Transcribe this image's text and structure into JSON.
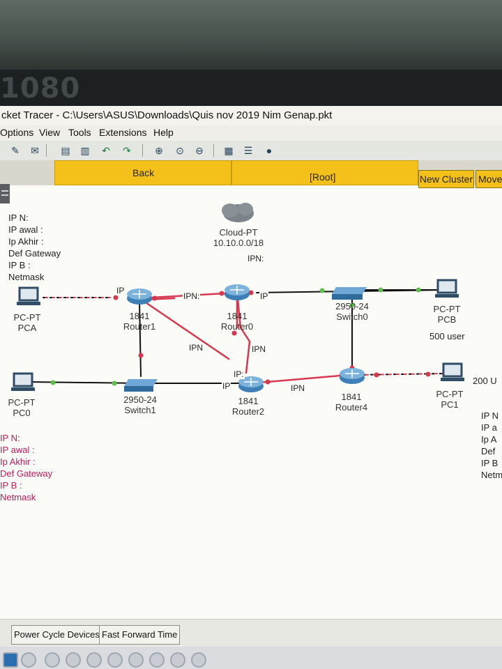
{
  "desktop": {
    "resolution_label": "1080"
  },
  "window": {
    "title": "cket Tracer - C:\\Users\\ASUS\\Downloads\\Quis nov 2019 Nim Genap.pkt"
  },
  "menu": [
    "Options",
    "View",
    "Tools",
    "Extensions",
    "Help"
  ],
  "toolbar": {
    "icons": [
      "activity-wizard-icon",
      "message-icon",
      "copy-icon",
      "print-icon",
      "undo-icon",
      "redo-icon",
      "zoom-in-icon",
      "zoom-reset-icon",
      "zoom-out-icon",
      "palette-icon",
      "device-template-icon",
      "cluster-icon"
    ]
  },
  "logical_bar": {
    "back_label": "Back",
    "root_label": "[Root]",
    "new_cluster_label": "New Cluster",
    "move_label": "Move"
  },
  "notes": {
    "top_left": "IP N:\nIP awal :\nIp Akhir :\nDef Gateway\nIP B :\nNetmask",
    "bottom_left": "IP N:\nIP awal :\nIp Akhir :\nDef Gateway\nIP B :\nNetmask",
    "right": "IP N\nIP a\nIp A\nDef\nIP B\nNetm",
    "pcb_users": "500 user",
    "pc1_users": "200 U"
  },
  "devices": {
    "cloud": {
      "model": "Cloud-PT",
      "network": "10.10.0.0/18"
    },
    "router0": {
      "model": "1841",
      "name": "Router0"
    },
    "router1": {
      "model": "1841",
      "name": "Router1"
    },
    "router2": {
      "model": "1841",
      "name": "Router2"
    },
    "router4": {
      "model": "1841",
      "name": "Router4"
    },
    "switch0": {
      "model": "2950-24",
      "name": "Switch0"
    },
    "switch1": {
      "model": "2950-24",
      "name": "Switch1"
    },
    "pca": {
      "model": "PC-PT",
      "name": "PCA"
    },
    "pcb": {
      "model": "PC-PT",
      "name": "PCB"
    },
    "pc0": {
      "model": "PC-PT",
      "name": "PC0"
    },
    "pc1": {
      "model": "PC-PT",
      "name": "PC1"
    }
  },
  "link_labels": {
    "cloud_router0": "IPN:",
    "router1_router0": "IPN:",
    "router0_switch0": "IP",
    "router1_pca": "IP",
    "router1_router2": "IPN",
    "router0_router2": "IPN",
    "router2_top": "IP:",
    "switch1_router2": "IP",
    "router2_router4": "IPN"
  },
  "bottom": {
    "power_cycle_label": "Power Cycle Devices",
    "fast_forward_label": "Fast Forward Time"
  },
  "colors": {
    "accent_bar": "#f3c11a",
    "link_red": "#d7374f",
    "link_black": "#111111",
    "note_red": "#c2185b"
  }
}
